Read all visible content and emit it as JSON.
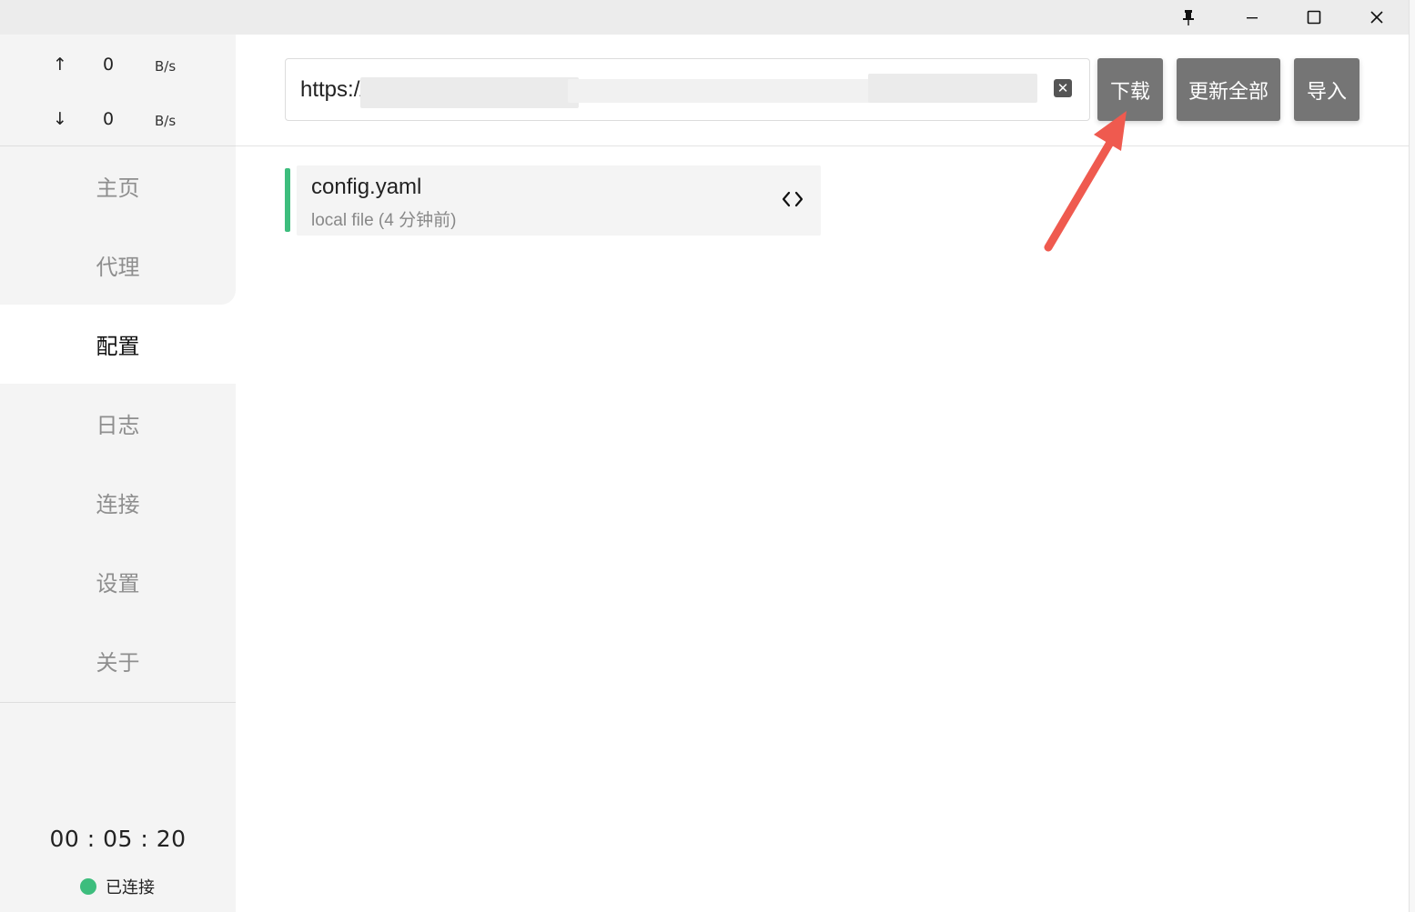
{
  "titlebar": {
    "pin_icon": "pin-icon",
    "minimize_icon": "minimize-icon",
    "maximize_icon": "maximize-icon",
    "close_icon": "close-icon"
  },
  "traffic": {
    "up_arrow": "↑",
    "up_value": "0",
    "up_unit": "B/s",
    "down_arrow": "↓",
    "down_value": "0",
    "down_unit": "B/s"
  },
  "nav": {
    "items": [
      {
        "label": "主页"
      },
      {
        "label": "代理"
      },
      {
        "label": "配置"
      },
      {
        "label": "日志"
      },
      {
        "label": "连接"
      },
      {
        "label": "设置"
      },
      {
        "label": "关于"
      }
    ],
    "active": "配置"
  },
  "status": {
    "uptime": "00 : 05 : 20",
    "connection": "已连接",
    "dot_color": "#3dbd7d"
  },
  "url_input": {
    "value": "https://",
    "clear_icon": "clear-icon"
  },
  "actions": {
    "download_label": "下载",
    "update_all_label": "更新全部",
    "import_label": "导入"
  },
  "profiles": [
    {
      "name": "config.yaml",
      "meta": "local file (4 分钟前)",
      "accent_color": "#3dbd7d",
      "edit_icon": "code-icon"
    }
  ],
  "annotation": {
    "arrow_color": "#ef5a4f"
  }
}
